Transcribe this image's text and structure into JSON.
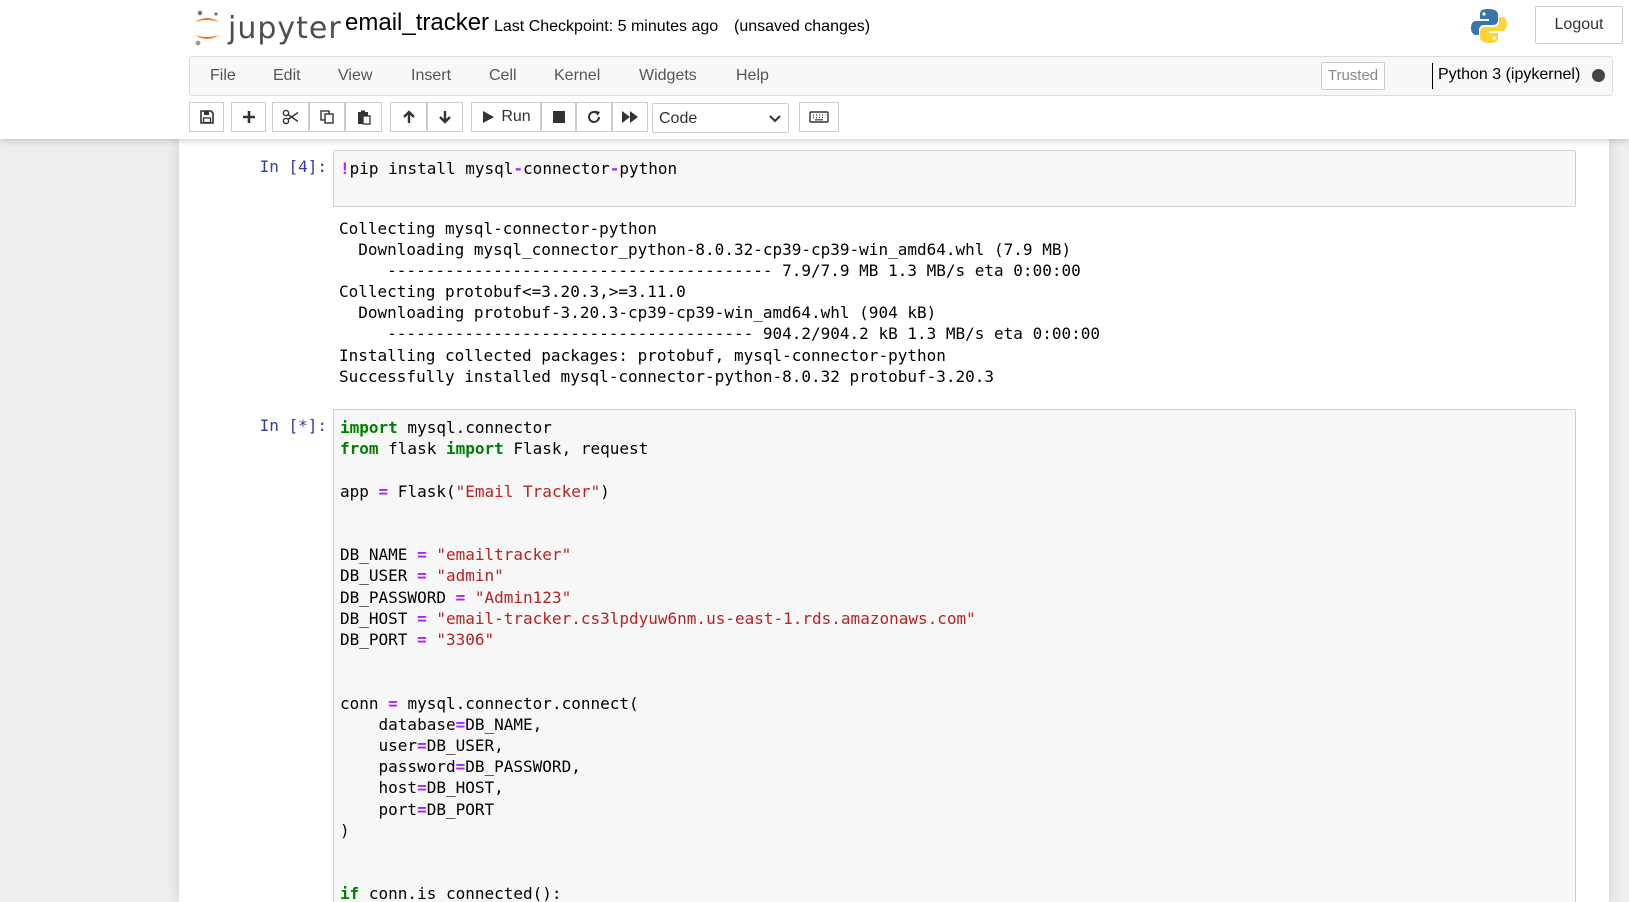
{
  "header": {
    "logo_text": "jupyter",
    "notebook_name": "email_tracker",
    "checkpoint": "Last Checkpoint: 5 minutes ago",
    "unsaved": "(unsaved changes)",
    "logout_label": "Logout"
  },
  "menu": {
    "items": [
      "File",
      "Edit",
      "View",
      "Insert",
      "Cell",
      "Kernel",
      "Widgets",
      "Help"
    ],
    "trusted_label": "Trusted",
    "kernel_name": "Python 3 (ipykernel)"
  },
  "toolbar": {
    "run_label": "Run",
    "cell_type": "Code",
    "icons": [
      "save-icon",
      "plus-icon",
      "cut-icon",
      "copy-icon",
      "paste-icon",
      "arrow-up-icon",
      "arrow-down-icon",
      "run-icon",
      "stop-icon",
      "restart-icon",
      "fast-forward-icon",
      "keyboard-icon"
    ]
  },
  "colors": {
    "prompt": "#303f9f",
    "keyword": "#008000",
    "operator": "#aa22ff",
    "string": "#ba2121",
    "kernel_indicator": "#444444"
  },
  "cells": [
    {
      "prompt": "In [4]:",
      "code": [
        [
          [
            "op",
            "!"
          ],
          [
            "",
            "pip install mysql"
          ],
          [
            "op",
            "-"
          ],
          [
            "",
            "connector"
          ],
          [
            "op",
            "-"
          ],
          [
            "",
            "python"
          ]
        ]
      ],
      "output": [
        "Collecting mysql-connector-python",
        "  Downloading mysql_connector_python-8.0.32-cp39-cp39-win_amd64.whl (7.9 MB)",
        "     ---------------------------------------- 7.9/7.9 MB 1.3 MB/s eta 0:00:00",
        "Collecting protobuf<=3.20.3,>=3.11.0",
        "  Downloading protobuf-3.20.3-cp39-cp39-win_amd64.whl (904 kB)",
        "     -------------------------------------- 904.2/904.2 kB 1.3 MB/s eta 0:00:00",
        "Installing collected packages: protobuf, mysql-connector-python",
        "Successfully installed mysql-connector-python-8.0.32 protobuf-3.20.3"
      ]
    },
    {
      "prompt": "In [*]:",
      "code": [
        [
          [
            "kw",
            "import"
          ],
          [
            "",
            " mysql.connector"
          ]
        ],
        [
          [
            "kw",
            "from"
          ],
          [
            "",
            " flask "
          ],
          [
            "kw",
            "import"
          ],
          [
            "",
            " Flask, request"
          ]
        ],
        [],
        [
          [
            "",
            "app "
          ],
          [
            "op",
            "="
          ],
          [
            "",
            " Flask("
          ],
          [
            "str",
            "\"Email Tracker\""
          ],
          [
            "",
            ")"
          ]
        ],
        [],
        [],
        [
          [
            "",
            "DB_NAME "
          ],
          [
            "op",
            "="
          ],
          [
            "",
            " "
          ],
          [
            "str",
            "\"emailtracker\""
          ]
        ],
        [
          [
            "",
            "DB_USER "
          ],
          [
            "op",
            "="
          ],
          [
            "",
            " "
          ],
          [
            "str",
            "\"admin\""
          ]
        ],
        [
          [
            "",
            "DB_PASSWORD "
          ],
          [
            "op",
            "="
          ],
          [
            "",
            " "
          ],
          [
            "str",
            "\"Admin123\""
          ]
        ],
        [
          [
            "",
            "DB_HOST "
          ],
          [
            "op",
            "="
          ],
          [
            "",
            " "
          ],
          [
            "str",
            "\"email-tracker.cs3lpdyuw6nm.us-east-1.rds.amazonaws.com\""
          ]
        ],
        [
          [
            "",
            "DB_PORT "
          ],
          [
            "op",
            "="
          ],
          [
            "",
            " "
          ],
          [
            "str",
            "\"3306\""
          ]
        ],
        [],
        [],
        [
          [
            "",
            "conn "
          ],
          [
            "op",
            "="
          ],
          [
            "",
            " mysql.connector.connect("
          ]
        ],
        [
          [
            "",
            "    database"
          ],
          [
            "op",
            "="
          ],
          [
            "",
            "DB_NAME,"
          ]
        ],
        [
          [
            "",
            "    user"
          ],
          [
            "op",
            "="
          ],
          [
            "",
            "DB_USER,"
          ]
        ],
        [
          [
            "",
            "    password"
          ],
          [
            "op",
            "="
          ],
          [
            "",
            "DB_PASSWORD,"
          ]
        ],
        [
          [
            "",
            "    host"
          ],
          [
            "op",
            "="
          ],
          [
            "",
            "DB_HOST,"
          ]
        ],
        [
          [
            "",
            "    port"
          ],
          [
            "op",
            "="
          ],
          [
            "",
            "DB_PORT"
          ]
        ],
        [
          [
            "",
            ")"
          ]
        ],
        [],
        [],
        [
          [
            "kw",
            "if"
          ],
          [
            "",
            " conn.is_connected():"
          ]
        ]
      ]
    }
  ]
}
